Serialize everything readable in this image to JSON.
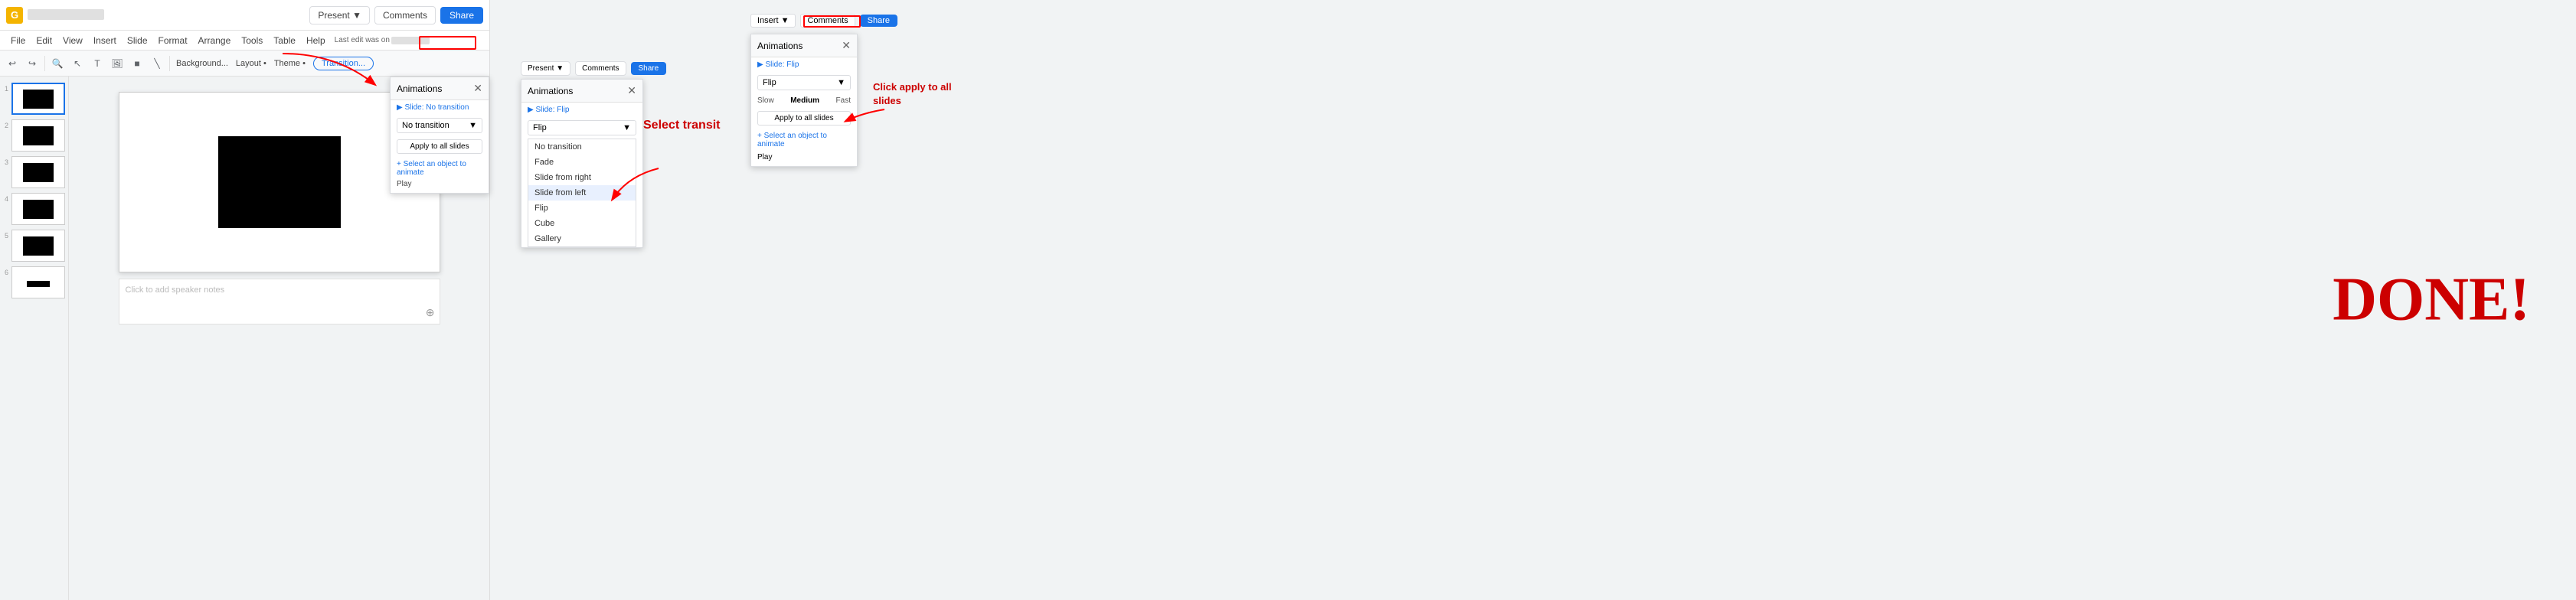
{
  "app": {
    "title": "Google Slides",
    "google_icon": "G"
  },
  "editor": {
    "doc_title_placeholder": "",
    "last_edit": "Last edit was on",
    "menu": [
      "File",
      "Edit",
      "View",
      "Insert",
      "Slide",
      "Format",
      "Arrange",
      "Tools",
      "Help",
      "Table"
    ],
    "toolbar": {
      "transition_btn": "Transition...",
      "background_btn": "Background...",
      "layout_btn": "Layout •",
      "theme_btn": "Theme •"
    },
    "slides": [
      {
        "num": "1"
      },
      {
        "num": "2"
      },
      {
        "num": "3"
      },
      {
        "num": "4"
      },
      {
        "num": "5"
      },
      {
        "num": "6"
      }
    ],
    "canvas": {
      "speaker_notes": "Click to add speaker notes"
    },
    "present_btn": "Present ▼",
    "comments_btn": "Comments",
    "share_btn": "Share"
  },
  "animations_panel_1": {
    "title": "Animations",
    "slide_title": "▶ Slide: No transition",
    "dropdown_value": "No transition",
    "apply_btn": "Apply to all slides",
    "select_obj": "+ Select an object to animate",
    "play_btn": "Play"
  },
  "section2": {
    "present_btn": "Present ▼",
    "comments_btn": "Comments",
    "share_btn": "Share",
    "panel": {
      "title": "Animations",
      "slide_title": "▶ Slide: Flip",
      "dropdown_value": "Flip",
      "dropdown_items": [
        "No transition",
        "Fade",
        "Slide from right",
        "Slide from left",
        "Flip",
        "Cube",
        "Gallery"
      ],
      "selected_item": "Slide from left"
    },
    "arrow_label": "Select transit"
  },
  "section3": {
    "insert_btn": "Insert ▼",
    "comments_btn": "Comments",
    "share_btn": "Share",
    "panel": {
      "title": "Animations",
      "slide_title": "▶ Slide: Flip",
      "dropdown_value": "Flip",
      "speed_slow": "Slow",
      "speed_medium": "Medium",
      "speed_fast": "Fast",
      "apply_btn": "Apply to all slides",
      "select_obj": "+ Select an object to animate",
      "play_btn": "Play"
    },
    "click_apply_label": "Click apply to all slides"
  },
  "done": {
    "label": "DONE!"
  }
}
